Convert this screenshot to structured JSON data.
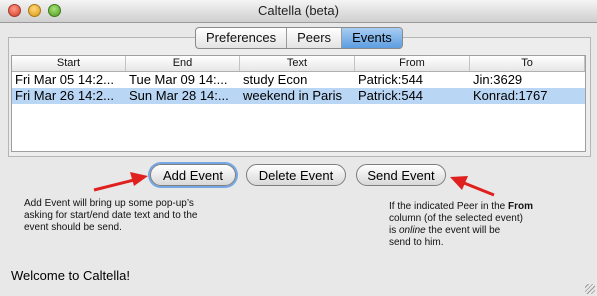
{
  "window": {
    "title": "Caltella (beta)"
  },
  "tabs": [
    {
      "label": "Preferences",
      "active": false
    },
    {
      "label": "Peers",
      "active": false
    },
    {
      "label": "Events",
      "active": true
    }
  ],
  "events_table": {
    "columns": [
      "Start",
      "End",
      "Text",
      "From",
      "To"
    ],
    "rows": [
      [
        "Fri Mar 05 14:2...",
        "Tue Mar 09 14:...",
        "study Econ",
        "Patrick:544",
        "Jin:3629"
      ],
      [
        "Fri Mar 26 14:2...",
        "Sun Mar 28 14:...",
        "weekend in Paris",
        "Patrick:544",
        "Konrad:1767"
      ]
    ],
    "selected_row": 1
  },
  "buttons": {
    "add": "Add Event",
    "delete": "Delete Event",
    "send": "Send Event"
  },
  "annotations": {
    "left": [
      "Add Event will bring up some pop-up’s",
      "asking for start/end date text and to the",
      "event should be send."
    ],
    "right": {
      "line1": "If the indicated Peer in the ",
      "line1_bold": "From",
      "line2": "column (of the selected event)",
      "line3_pre": "is ",
      "line3_italic": "online",
      "line3_post": " the event will be",
      "line4": "send to him."
    }
  },
  "status": "Welcome to Caltella!",
  "colors": {
    "accent": "#5d9de0",
    "selection": "#b9d6f4",
    "arrow": "#e0201e"
  }
}
